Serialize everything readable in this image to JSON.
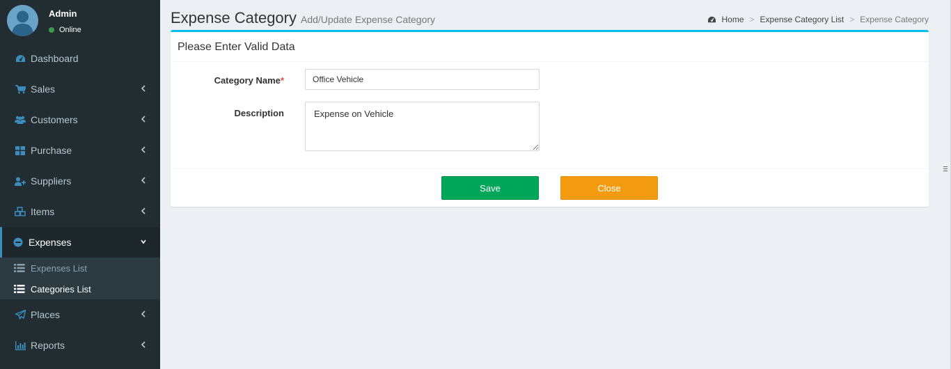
{
  "user": {
    "name": "Admin",
    "status": "Online"
  },
  "menu": [
    {
      "label": "Dashboard",
      "icon": "dashboard-icon",
      "has_chevron": false
    },
    {
      "label": "Sales",
      "icon": "cart-icon",
      "has_chevron": true
    },
    {
      "label": "Customers",
      "icon": "users-icon",
      "has_chevron": true
    },
    {
      "label": "Purchase",
      "icon": "grid-icon",
      "has_chevron": true
    },
    {
      "label": "Suppliers",
      "icon": "user-plus-icon",
      "has_chevron": true
    },
    {
      "label": "Items",
      "icon": "cubes-icon",
      "has_chevron": true
    },
    {
      "label": "Expenses",
      "icon": "minus-circle-icon",
      "has_chevron": true,
      "active": true
    },
    {
      "label": "Places",
      "icon": "paper-plane-icon",
      "has_chevron": true
    },
    {
      "label": "Reports",
      "icon": "bar-chart-icon",
      "has_chevron": true
    }
  ],
  "submenu": [
    {
      "label": "Expenses List",
      "icon": "list-icon"
    },
    {
      "label": "Categories List",
      "icon": "list-icon",
      "current": true
    }
  ],
  "page": {
    "title": "Expense Category",
    "subtitle": "Add/Update Expense Category"
  },
  "breadcrumb": {
    "home": "Home",
    "list": "Expense Category List",
    "current": "Expense Category",
    "sep": ">"
  },
  "form": {
    "header": "Please Enter Valid Data",
    "category_label": "Category Name",
    "required_mark": "*",
    "category_value": "Office Vehicle",
    "description_label": "Description",
    "description_value": "Expense on Vehicle",
    "save_label": "Save",
    "close_label": "Close"
  },
  "colors": {
    "sidebar": "#222d32",
    "accent": "#00c0ef",
    "save": "#00a65a",
    "close": "#f39c12",
    "icon": "#3c8dbc"
  }
}
